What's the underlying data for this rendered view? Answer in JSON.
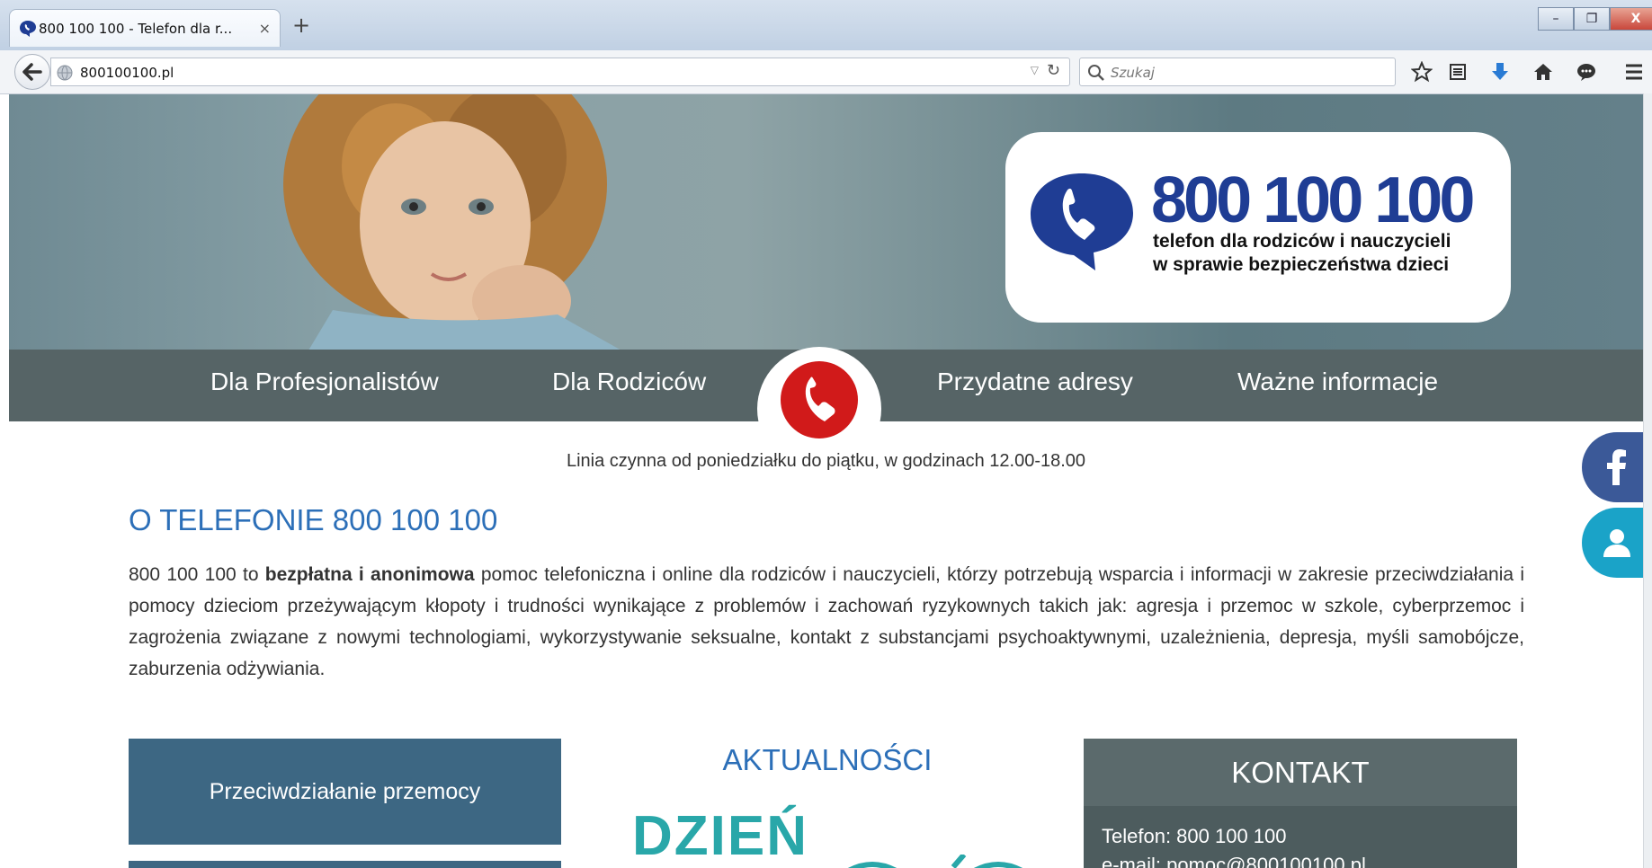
{
  "browser": {
    "tab_title": "800 100 100 - Telefon dla r...",
    "tab_close": "×",
    "new_tab": "+",
    "url": "800100100.pl",
    "search_placeholder": "Szukaj",
    "window_controls": {
      "minimize": "–",
      "restore": "❐",
      "close": "X"
    }
  },
  "header": {
    "logo_number": "800 100 100",
    "logo_tagline_1": "telefon dla rodziców i nauczycieli",
    "logo_tagline_2": "w sprawie bezpieczeństwa dzieci"
  },
  "menu": {
    "items": [
      "Dla Profesjonalistów",
      "Dla Rodziców",
      "Przydatne adresy",
      "Ważne informacje"
    ]
  },
  "hours": "Linia czynna od poniedziałku do piątku, w godzinach 12.00-18.00",
  "about": {
    "title": "O TELEFONIE 800 100 100",
    "text_lead": "800 100 100 to ",
    "text_bold": "bezpłatna i anonimowa",
    "text_rest": " pomoc telefoniczna i online dla rodziców i nauczycieli, którzy potrzebują wsparcia i informacji w zakresie przeciwdziałania i pomocy dzieciom przeżywającym kłopoty i trudności wynikające z problemów i zachowań ryzykownych takich jak: agresja i przemoc w szkole, cyberprzemoc i zagrożenia związane z nowymi technologiami, wykorzystywanie seksualne, kontakt z substancjami psychoaktywnymi, uzależnienia, depresja, myśli samobójcze, zaburzenia odżywiania."
  },
  "sidebar": {
    "buttons": [
      "Przeciwdziałanie przemocy"
    ]
  },
  "news": {
    "title": "AKTUALNOŚCI",
    "image_text": "DZIEŃ"
  },
  "contact": {
    "title": "KONTAKT",
    "phone": "Telefon: 800 100 100",
    "email": "e-mail: pomoc@800100100.pl"
  },
  "colors": {
    "brand_blue": "#1f3d94",
    "heading_blue": "#2c6fb8",
    "menu_bg": "#566466",
    "phone_red": "#d11a1a",
    "side_button": "#3d6783",
    "facebook": "#3b5998",
    "user_button": "#1aa3c8"
  },
  "icons": [
    "back-arrow-icon",
    "globe-icon",
    "reload-icon",
    "search-icon",
    "star-icon",
    "reading-list-icon",
    "download-icon",
    "home-icon",
    "chat-icon",
    "menu-icon",
    "phone-icon",
    "facebook-icon",
    "user-icon"
  ]
}
